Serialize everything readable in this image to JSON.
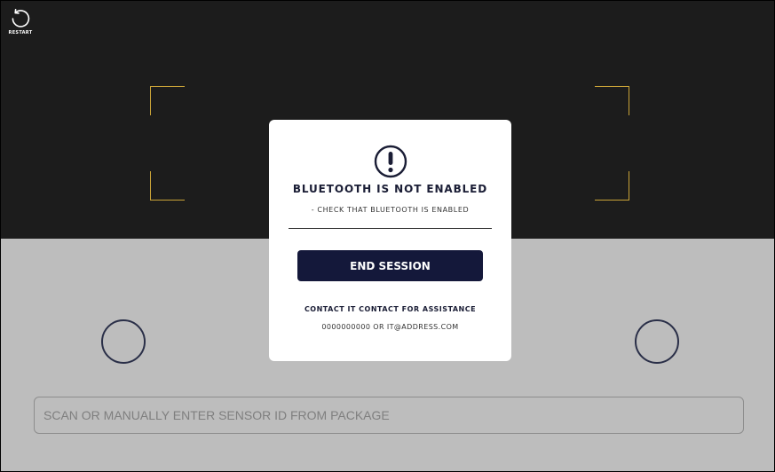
{
  "header": {
    "restart_label": "RESTART",
    "restart_icon": "restart-icon"
  },
  "modal": {
    "icon": "exclamation-circle-icon",
    "title": "BLUETOOTH IS NOT ENABLED",
    "subtitle": "- CHECK THAT BLUETOOTH IS ENABLED",
    "end_session_label": "END SESSION",
    "contact_heading": "CONTACT IT CONTACT FOR ASSISTANCE",
    "contact_info": "0000000000 OR IT@ADDRESS.COM"
  },
  "sensor": {
    "placeholder": "SCAN OR MANUALLY ENTER SENSOR ID FROM PACKAGE",
    "value": ""
  },
  "colors": {
    "camera_bg": "#1c1c1c",
    "lower_bg": "#bdbdbd",
    "scan_frame": "#c9a338",
    "navy": "#14183a",
    "ring": "#2a2f48"
  }
}
